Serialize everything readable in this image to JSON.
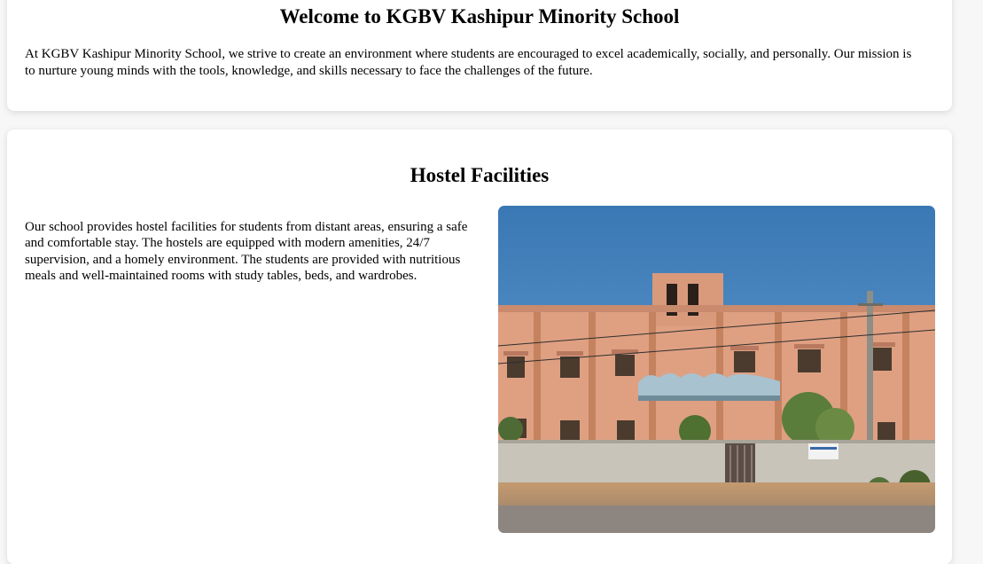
{
  "welcome": {
    "title": "Welcome to KGBV Kashipur Minority School",
    "text": "At KGBV Kashipur Minority School, we strive to create an environment where students are encouraged to excel academically, socially, and personally. Our mission is to nurture young minds with the tools, knowledge, and skills necessary to face the challenges of the future."
  },
  "hostel": {
    "title": "Hostel Facilities",
    "text": "Our school provides hostel facilities for students from distant areas, ensuring a safe and comfortable stay. The hostels are equipped with modern amenities, 24/7 supervision, and a homely environment. The students are provided with nutritious meals and well-maintained rooms with study tables, beds, and wardrobes."
  },
  "colors": {
    "sky": "#3f7fb8",
    "building": "#e2a183",
    "wall": "#c9c6bd",
    "ground": "#b8916d"
  }
}
